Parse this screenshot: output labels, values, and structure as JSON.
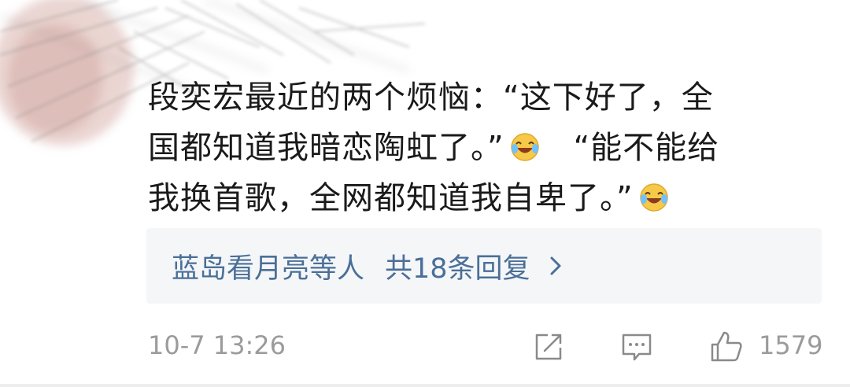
{
  "comment": {
    "line1": "段奕宏最近的两个烦恼：“这下好了，全",
    "line2": "国都知道我暗恋陶虹了。”",
    "line2b": "“能不能给",
    "line3": "我换首歌，全网都知道我自卑了。”",
    "emoji_icon": "laugh-cry-emoji-icon"
  },
  "replies": {
    "names": "蓝岛看月亮等人",
    "count_label": "共18条回复",
    "chevron_icon": "chevron-right-icon"
  },
  "footer": {
    "timestamp": "10-7 13:26",
    "like_count": "1579",
    "share_icon": "share-icon",
    "comment_icon": "comment-icon",
    "like_icon": "thumbs-up-icon"
  },
  "colors": {
    "text": "#1a1a1a",
    "link": "#4a6f98",
    "muted": "#9b9b9b",
    "reply_bg": "#f5f6f8"
  }
}
